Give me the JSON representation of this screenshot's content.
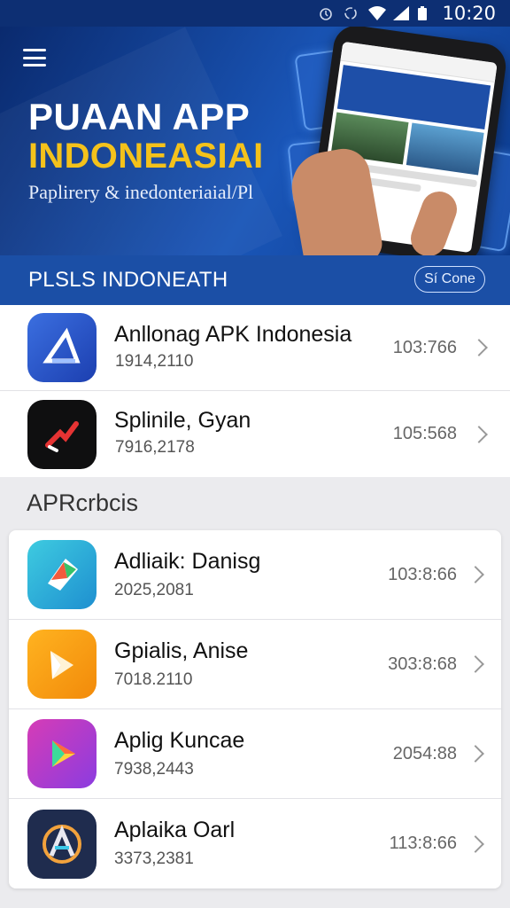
{
  "status_bar": {
    "time": "10:20"
  },
  "hero": {
    "title_line_1": "PUAAN APP",
    "title_line_2": "INDONEASIAI",
    "subtitle": "Paplirery & inedonteriaial/Pl"
  },
  "section_1": {
    "title": "PLSLS INDONEATH",
    "button_label": "Sí Cone"
  },
  "list_1": [
    {
      "name": "Anllonag APK Indonesia",
      "meta": "1914,2110",
      "number": "103:766",
      "icon": "blue-arrow-app-icon"
    },
    {
      "name": "Splinile, Gyan",
      "meta": "7916,2178",
      "number": "105:568",
      "icon": "black-red-app-icon"
    }
  ],
  "section_2": {
    "title": "APRcrbcis"
  },
  "list_2": [
    {
      "name": "Adliaik: Danisg",
      "meta": "2025,2081",
      "number": "103:8:66",
      "icon": "multicolor-cube-app-icon"
    },
    {
      "name": "Gpialis, Anise",
      "meta": "7018.2110",
      "number": "303:8:68",
      "icon": "orange-app-icon"
    },
    {
      "name": "Aplig Kuncae",
      "meta": "7938,2443",
      "number": "2054:88",
      "icon": "play-gradient-app-icon"
    },
    {
      "name": "Aplaika Oarl",
      "meta": "3373,2381",
      "number": "113:8:66",
      "icon": "letter-a-app-icon"
    }
  ],
  "colors": {
    "hero_blue": "#1a56b8",
    "section_blue": "#1b4fa6",
    "accent_yellow": "#f4c21b"
  }
}
